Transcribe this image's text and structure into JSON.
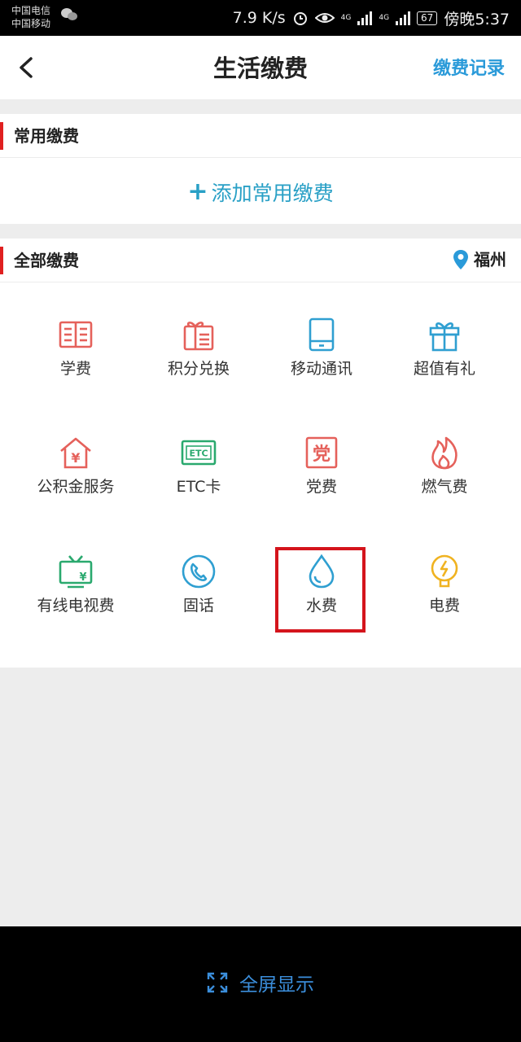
{
  "status_bar": {
    "carrier_1": "中国电信",
    "carrier_2": "中国移动",
    "net_speed": "7.9 K/s",
    "net_type_1": "4G",
    "net_type_2": "4G",
    "battery": "67",
    "time": "傍晚5:37"
  },
  "nav": {
    "title": "生活缴费",
    "records_label": "缴费记录"
  },
  "common_section": {
    "title": "常用缴费",
    "add_label": "添加常用缴费"
  },
  "all_section": {
    "title": "全部缴费",
    "city": "福州",
    "items": [
      {
        "label": "学费",
        "icon": "book-icon",
        "color": "#e5615b"
      },
      {
        "label": "积分兑换",
        "icon": "gift-card-icon",
        "color": "#e5615b"
      },
      {
        "label": "移动通讯",
        "icon": "mobile-phone-icon",
        "color": "#2f9fd1"
      },
      {
        "label": "超值有礼",
        "icon": "gift-icon",
        "color": "#2f9fd1"
      },
      {
        "label": "公积金服务",
        "icon": "house-yuan-icon",
        "color": "#e5615b"
      },
      {
        "label": "ETC卡",
        "icon": "etc-card-icon",
        "color": "#2aa96e"
      },
      {
        "label": "党费",
        "icon": "party-icon",
        "color": "#e5615b"
      },
      {
        "label": "燃气费",
        "icon": "flame-icon",
        "color": "#e5615b"
      },
      {
        "label": "有线电视费",
        "icon": "tv-icon",
        "color": "#2aa96e"
      },
      {
        "label": "固话",
        "icon": "landline-icon",
        "color": "#2f9fd1"
      },
      {
        "label": "水费",
        "icon": "water-drop-icon",
        "color": "#2f9fd1"
      },
      {
        "label": "电费",
        "icon": "bulb-icon",
        "color": "#f0b321"
      }
    ],
    "party_glyph": "党",
    "etc_glyph": "ETC",
    "yuan_glyph": "¥"
  },
  "highlight_color": "#d4141c",
  "bottom_bar": {
    "fullscreen_label": "全屏显示"
  }
}
